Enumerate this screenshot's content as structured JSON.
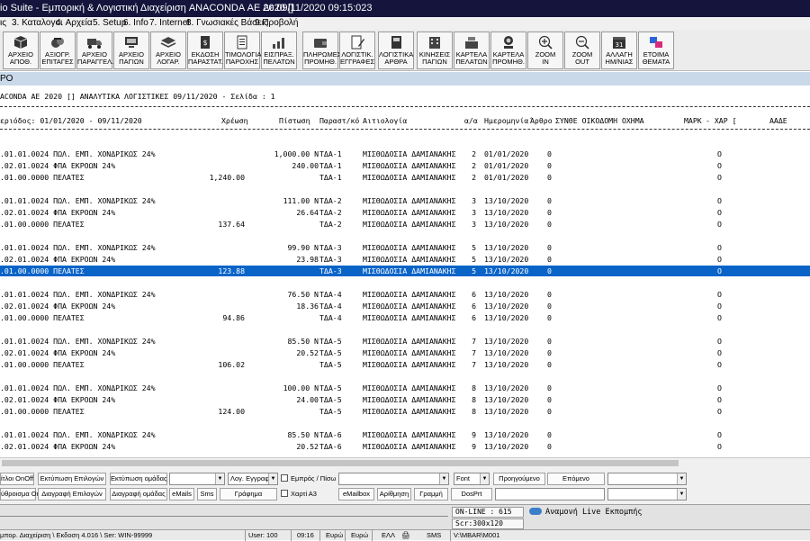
{
  "window": {
    "title": "io Suite - Εμπορική  &  Λογιστική Διαχείριση ANACONDA ΑΕ 2020 []",
    "datetime": "Δε 09/11/2020  09:15:023"
  },
  "menu": [
    "ις",
    "3. Καταλογοι",
    "4. Αρχεία",
    "5. Setup",
    "6. Info",
    "7. Internet",
    "8. Γνωσιακές Βάσεις",
    "9.Προβολή"
  ],
  "toolbar": [
    {
      "label": "ΑΡΧΕΙΟ\nΑΠΟΘ.",
      "icon": "box-icon"
    },
    {
      "label": "ΑΞΙΟΓΡ.\nΕΠΙΤΑΓΕΣ",
      "icon": "cheque-icon"
    },
    {
      "label": "ΑΡΧΕΙΟ\nΠΑΡΑΓΓΕΛ.",
      "icon": "truck-icon"
    },
    {
      "label": "ΑΡΧΕΙΟ\nΠΑΓΙΩΝ",
      "icon": "computer-icon"
    },
    {
      "label": "ΑΡΧΕΙΟ\nΛΟΓΑΡ.",
      "icon": "layers-icon"
    },
    {
      "label": "ΕΚΔΟΣΗ\nΠΑΡΑΣΤΑΤ.",
      "icon": "invoice-icon"
    },
    {
      "label": "ΤΙΜΟΛΟΓΙΑ\nΠΑΡΟΧΗΣ",
      "icon": "document-icon"
    },
    {
      "label": "ΕΙΣΠΡΑΞ.\nΠΕΛΑΤΩΝ",
      "icon": "chart-icon"
    },
    {
      "label": "ΠΛΗΡΩΜΕΣ\nΠΡΟΜΗΘ.",
      "icon": "wallet-icon"
    },
    {
      "label": "ΛΟΓΙΣΤΙΚ.\nΕΓΓΡΑΦΕΣ",
      "icon": "pen-document-icon"
    },
    {
      "label": "ΛΟΓΙΣΤΙΚΑ\nΑΡΘΡΑ",
      "icon": "book-icon"
    },
    {
      "label": "ΚΙΝΗΣΕΙΣ\nΠΑΓΙΩΝ",
      "icon": "building-icon"
    },
    {
      "label": "ΚΑΡΤΕΛΑ\nΠΕΛΑΤΩΝ",
      "icon": "cash-register-icon"
    },
    {
      "label": "ΚΑΡΤΕΛΑ\nΠΡΟΜΗΘ.",
      "icon": "person-icon"
    },
    {
      "label": "ZOOM\nIN",
      "icon": "zoom-in-icon"
    },
    {
      "label": "ZOOM\nOUT",
      "icon": "zoom-out-icon"
    },
    {
      "label": "ΑΛΛΑΓΗ\nΗΜ/ΝΙΑΣ",
      "icon": "calendar-icon",
      "day": "31"
    },
    {
      "label": "ΕΤΟΙΜΑ\nΘΕΜΑΤΑ",
      "icon": "squares-icon"
    }
  ],
  "panel_title": "ΡΟ",
  "report": {
    "title": "ACONDA ΑΕ 2020 [] ΑΝΑΛΥΤΙΚΑ ΛΟΓΙΣΤΙΚΕΣ 09/11/2020 - Σελίδα : 1",
    "headers": {
      "period": "εριόδος: 01/01/2020 - 09/11/2020",
      "debit": "Χρέωση",
      "credit": "Πίστωση",
      "doc": "Παραστ/κό",
      "reason": "Αιτιολογία",
      "aa": "α/α",
      "date": "Ημερομηνία",
      "art": "Άρθρο",
      "rest": "ΣΥΝΘΕ ΟΙΚΟΔΟΜΗ  ΟΧΗΜΑ",
      "mark": "ΜΑΡΚ",
      "xar": "- ΧΑΡ [",
      "aade": "ΑΑΔΕ"
    },
    "rows": [
      {
        "acc": ".01.01.0024 ΠΩΛ. ΕΜΠ. ΧΟΝΔΡΙΚΩΣ 24%",
        "debit": "",
        "credit": "1,000.00 Ν",
        "doc": "ΤΔΑ-1",
        "reason": "ΜΙΣΘΩΔΟΣΙΑ ΔΑΜΙΑΝΑΚΗΣ",
        "aa": "2",
        "date": "01/01/2020",
        "art": "0",
        "o": "O"
      },
      {
        "acc": ".02.01.0024 ΦΠΑ ΕΚΡΟΩΝ 24%",
        "debit": "",
        "credit": "240.00",
        "doc": "ΤΔΑ-1",
        "reason": "ΜΙΣΘΩΔΟΣΙΑ ΔΑΜΙΑΝΑΚΗΣ",
        "aa": "2",
        "date": "01/01/2020",
        "art": "0",
        "o": "O"
      },
      {
        "acc": ".01.00.0000 ΠΕΛΑΤΕΣ",
        "debit": "1,240.00",
        "credit": "",
        "doc": "ΤΔΑ-1",
        "reason": "ΜΙΣΘΩΔΟΣΙΑ ΔΑΜΙΑΝΑΚΗΣ",
        "aa": "2",
        "date": "01/01/2020",
        "art": "0",
        "o": "O"
      },
      {
        "acc": ".01.01.0024 ΠΩΛ. ΕΜΠ. ΧΟΝΔΡΙΚΩΣ 24%",
        "debit": "",
        "credit": "111.00 Ν",
        "doc": "ΤΔΑ-2",
        "reason": "ΜΙΣΘΩΔΟΣΙΑ ΔΑΜΙΑΝΑΚΗΣ",
        "aa": "3",
        "date": "13/10/2020",
        "art": "0",
        "o": "O"
      },
      {
        "acc": ".02.01.0024 ΦΠΑ ΕΚΡΟΩΝ 24%",
        "debit": "",
        "credit": "26.64",
        "doc": "ΤΔΑ-2",
        "reason": "ΜΙΣΘΩΔΟΣΙΑ ΔΑΜΙΑΝΑΚΗΣ",
        "aa": "3",
        "date": "13/10/2020",
        "art": "0",
        "o": "O"
      },
      {
        "acc": ".01.00.0000 ΠΕΛΑΤΕΣ",
        "debit": "137.64",
        "credit": "",
        "doc": "ΤΔΑ-2",
        "reason": "ΜΙΣΘΩΔΟΣΙΑ ΔΑΜΙΑΝΑΚΗΣ",
        "aa": "3",
        "date": "13/10/2020",
        "art": "0",
        "o": "O"
      },
      {
        "acc": ".01.01.0024 ΠΩΛ. ΕΜΠ. ΧΟΝΔΡΙΚΩΣ 24%",
        "debit": "",
        "credit": "99.90 Ν",
        "doc": "ΤΔΑ-3",
        "reason": "ΜΙΣΘΩΔΟΣΙΑ ΔΑΜΙΑΝΑΚΗΣ",
        "aa": "5",
        "date": "13/10/2020",
        "art": "0",
        "o": "O"
      },
      {
        "acc": ".02.01.0024 ΦΠΑ ΕΚΡΟΩΝ 24%",
        "debit": "",
        "credit": "23.98",
        "doc": "ΤΔΑ-3",
        "reason": "ΜΙΣΘΩΔΟΣΙΑ ΔΑΜΙΑΝΑΚΗΣ",
        "aa": "5",
        "date": "13/10/2020",
        "art": "0",
        "o": "O"
      },
      {
        "acc": ".01.00.0000 ΠΕΛΑΤΕΣ",
        "debit": "123.88",
        "credit": "",
        "doc": "ΤΔΑ-3",
        "reason": "ΜΙΣΘΩΔΟΣΙΑ ΔΑΜΙΑΝΑΚΗΣ",
        "aa": "5",
        "date": "13/10/2020",
        "art": "0",
        "o": "O",
        "selected": true
      },
      {
        "acc": ".01.01.0024 ΠΩΛ. ΕΜΠ. ΧΟΝΔΡΙΚΩΣ 24%",
        "debit": "",
        "credit": "76.50 Ν",
        "doc": "ΤΔΑ-4",
        "reason": "ΜΙΣΘΩΔΟΣΙΑ ΔΑΜΙΑΝΑΚΗΣ",
        "aa": "6",
        "date": "13/10/2020",
        "art": "0",
        "o": "O"
      },
      {
        "acc": ".02.01.0024 ΦΠΑ ΕΚΡΟΩΝ 24%",
        "debit": "",
        "credit": "18.36",
        "doc": "ΤΔΑ-4",
        "reason": "ΜΙΣΘΩΔΟΣΙΑ ΔΑΜΙΑΝΑΚΗΣ",
        "aa": "6",
        "date": "13/10/2020",
        "art": "0",
        "o": "O"
      },
      {
        "acc": ".01.00.0000 ΠΕΛΑΤΕΣ",
        "debit": "94.86",
        "credit": "",
        "doc": "ΤΔΑ-4",
        "reason": "ΜΙΣΘΩΔΟΣΙΑ ΔΑΜΙΑΝΑΚΗΣ",
        "aa": "6",
        "date": "13/10/2020",
        "art": "0",
        "o": "O"
      },
      {
        "acc": ".01.01.0024 ΠΩΛ. ΕΜΠ. ΧΟΝΔΡΙΚΩΣ 24%",
        "debit": "",
        "credit": "85.50 Ν",
        "doc": "ΤΔΑ-5",
        "reason": "ΜΙΣΘΩΔΟΣΙΑ ΔΑΜΙΑΝΑΚΗΣ",
        "aa": "7",
        "date": "13/10/2020",
        "art": "0",
        "o": "O"
      },
      {
        "acc": ".02.01.0024 ΦΠΑ ΕΚΡΟΩΝ 24%",
        "debit": "",
        "credit": "20.52",
        "doc": "ΤΔΑ-5",
        "reason": "ΜΙΣΘΩΔΟΣΙΑ ΔΑΜΙΑΝΑΚΗΣ",
        "aa": "7",
        "date": "13/10/2020",
        "art": "0",
        "o": "O"
      },
      {
        "acc": ".01.00.0000 ΠΕΛΑΤΕΣ",
        "debit": "106.02",
        "credit": "",
        "doc": "ΤΔΑ-5",
        "reason": "ΜΙΣΘΩΔΟΣΙΑ ΔΑΜΙΑΝΑΚΗΣ",
        "aa": "7",
        "date": "13/10/2020",
        "art": "0",
        "o": "O"
      },
      {
        "acc": ".01.01.0024 ΠΩΛ. ΕΜΠ. ΧΟΝΔΡΙΚΩΣ 24%",
        "debit": "",
        "credit": "100.00 Ν",
        "doc": "ΤΔΑ-5",
        "reason": "ΜΙΣΘΩΔΟΣΙΑ ΔΑΜΙΑΝΑΚΗΣ",
        "aa": "8",
        "date": "13/10/2020",
        "art": "0",
        "o": "O"
      },
      {
        "acc": ".02.01.0024 ΦΠΑ ΕΚΡΟΩΝ 24%",
        "debit": "",
        "credit": "24.00",
        "doc": "ΤΔΑ-5",
        "reason": "ΜΙΣΘΩΔΟΣΙΑ ΔΑΜΙΑΝΑΚΗΣ",
        "aa": "8",
        "date": "13/10/2020",
        "art": "0",
        "o": "O"
      },
      {
        "acc": ".01.00.0000 ΠΕΛΑΤΕΣ",
        "debit": "124.00",
        "credit": "",
        "doc": "ΤΔΑ-5",
        "reason": "ΜΙΣΘΩΔΟΣΙΑ ΔΑΜΙΑΝΑΚΗΣ",
        "aa": "8",
        "date": "13/10/2020",
        "art": "0",
        "o": "O"
      },
      {
        "acc": ".01.01.0024 ΠΩΛ. ΕΜΠ. ΧΟΝΔΡΙΚΩΣ 24%",
        "debit": "",
        "credit": "85.50 Ν",
        "doc": "ΤΔΑ-6",
        "reason": "ΜΙΣΘΩΔΟΣΙΑ ΔΑΜΙΑΝΑΚΗΣ",
        "aa": "9",
        "date": "13/10/2020",
        "art": "0",
        "o": "O"
      },
      {
        "acc": ".02.01.0024 ΦΠΑ ΕΚΡΟΩΝ 24%",
        "debit": "",
        "credit": "20.52",
        "doc": "ΤΔΑ-6",
        "reason": "ΜΙΣΘΩΔΟΣΙΑ ΔΑΜΙΑΝΑΚΗΣ",
        "aa": "9",
        "date": "13/10/2020",
        "art": "0",
        "o": "O"
      }
    ]
  },
  "controls": {
    "row1": {
      "titles_toggle": "ίτλοι OnOff",
      "print_selected": "Εκτύπωση Επιλογών",
      "print_group": "Εκτύπωση ομάδας",
      "acc_entries": "Λογ. Εγγραφ",
      "front_back": "Εμπρός / Πίσω",
      "font": "Font",
      "previous": "Προηγούμενο",
      "next": "Επόμενο"
    },
    "row2": {
      "sum_toggle": "ύθροισμα OnOff",
      "delete_selected": "Διαγραφή Επιλογών",
      "delete_group": "Διαγραφή ομάδας",
      "emails": "eMails",
      "sms": "Sms",
      "graphics": "Γράφημα",
      "paper_a3": "Χαρτί Α3",
      "emailbox": "eMailbox",
      "number": "Αρίθμηση",
      "line": "Γραμμή",
      "dosprt": "DosPrt"
    }
  },
  "status": {
    "online": "ON-LINE : 615",
    "screen": "Scr:300x120",
    "live": "Αναμονή Live Εκπομπής",
    "path": "μπορ. Διαχείριση \\ Εκδοση 4.016 \\ Ser: WIN-99999",
    "user": "User: 100",
    "time": "09:16",
    "currency1": "Ευρώ",
    "currency2": "Ευρώ",
    "lang": "ΕΛΛ",
    "sms": "SMS",
    "share": "V:\\MBAR\\M001"
  }
}
